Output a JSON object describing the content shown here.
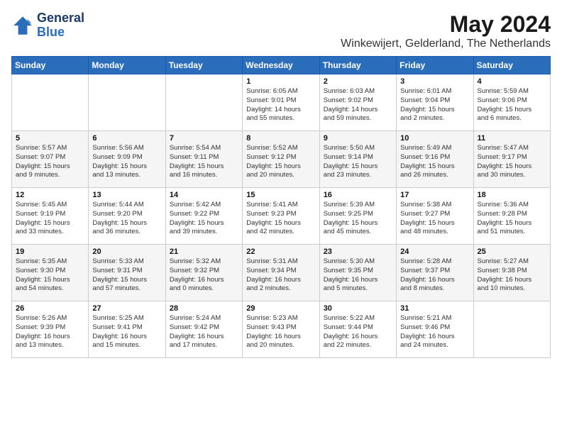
{
  "header": {
    "logo_line1": "General",
    "logo_line2": "Blue",
    "month": "May 2024",
    "location": "Winkewijert, Gelderland, The Netherlands"
  },
  "weekdays": [
    "Sunday",
    "Monday",
    "Tuesday",
    "Wednesday",
    "Thursday",
    "Friday",
    "Saturday"
  ],
  "weeks": [
    [
      {
        "day": "",
        "info": ""
      },
      {
        "day": "",
        "info": ""
      },
      {
        "day": "",
        "info": ""
      },
      {
        "day": "1",
        "info": "Sunrise: 6:05 AM\nSunset: 9:01 PM\nDaylight: 14 hours\nand 55 minutes."
      },
      {
        "day": "2",
        "info": "Sunrise: 6:03 AM\nSunset: 9:02 PM\nDaylight: 14 hours\nand 59 minutes."
      },
      {
        "day": "3",
        "info": "Sunrise: 6:01 AM\nSunset: 9:04 PM\nDaylight: 15 hours\nand 2 minutes."
      },
      {
        "day": "4",
        "info": "Sunrise: 5:59 AM\nSunset: 9:06 PM\nDaylight: 15 hours\nand 6 minutes."
      }
    ],
    [
      {
        "day": "5",
        "info": "Sunrise: 5:57 AM\nSunset: 9:07 PM\nDaylight: 15 hours\nand 9 minutes."
      },
      {
        "day": "6",
        "info": "Sunrise: 5:56 AM\nSunset: 9:09 PM\nDaylight: 15 hours\nand 13 minutes."
      },
      {
        "day": "7",
        "info": "Sunrise: 5:54 AM\nSunset: 9:11 PM\nDaylight: 15 hours\nand 16 minutes."
      },
      {
        "day": "8",
        "info": "Sunrise: 5:52 AM\nSunset: 9:12 PM\nDaylight: 15 hours\nand 20 minutes."
      },
      {
        "day": "9",
        "info": "Sunrise: 5:50 AM\nSunset: 9:14 PM\nDaylight: 15 hours\nand 23 minutes."
      },
      {
        "day": "10",
        "info": "Sunrise: 5:49 AM\nSunset: 9:16 PM\nDaylight: 15 hours\nand 26 minutes."
      },
      {
        "day": "11",
        "info": "Sunrise: 5:47 AM\nSunset: 9:17 PM\nDaylight: 15 hours\nand 30 minutes."
      }
    ],
    [
      {
        "day": "12",
        "info": "Sunrise: 5:45 AM\nSunset: 9:19 PM\nDaylight: 15 hours\nand 33 minutes."
      },
      {
        "day": "13",
        "info": "Sunrise: 5:44 AM\nSunset: 9:20 PM\nDaylight: 15 hours\nand 36 minutes."
      },
      {
        "day": "14",
        "info": "Sunrise: 5:42 AM\nSunset: 9:22 PM\nDaylight: 15 hours\nand 39 minutes."
      },
      {
        "day": "15",
        "info": "Sunrise: 5:41 AM\nSunset: 9:23 PM\nDaylight: 15 hours\nand 42 minutes."
      },
      {
        "day": "16",
        "info": "Sunrise: 5:39 AM\nSunset: 9:25 PM\nDaylight: 15 hours\nand 45 minutes."
      },
      {
        "day": "17",
        "info": "Sunrise: 5:38 AM\nSunset: 9:27 PM\nDaylight: 15 hours\nand 48 minutes."
      },
      {
        "day": "18",
        "info": "Sunrise: 5:36 AM\nSunset: 9:28 PM\nDaylight: 15 hours\nand 51 minutes."
      }
    ],
    [
      {
        "day": "19",
        "info": "Sunrise: 5:35 AM\nSunset: 9:30 PM\nDaylight: 15 hours\nand 54 minutes."
      },
      {
        "day": "20",
        "info": "Sunrise: 5:33 AM\nSunset: 9:31 PM\nDaylight: 15 hours\nand 57 minutes."
      },
      {
        "day": "21",
        "info": "Sunrise: 5:32 AM\nSunset: 9:32 PM\nDaylight: 16 hours\nand 0 minutes."
      },
      {
        "day": "22",
        "info": "Sunrise: 5:31 AM\nSunset: 9:34 PM\nDaylight: 16 hours\nand 2 minutes."
      },
      {
        "day": "23",
        "info": "Sunrise: 5:30 AM\nSunset: 9:35 PM\nDaylight: 16 hours\nand 5 minutes."
      },
      {
        "day": "24",
        "info": "Sunrise: 5:28 AM\nSunset: 9:37 PM\nDaylight: 16 hours\nand 8 minutes."
      },
      {
        "day": "25",
        "info": "Sunrise: 5:27 AM\nSunset: 9:38 PM\nDaylight: 16 hours\nand 10 minutes."
      }
    ],
    [
      {
        "day": "26",
        "info": "Sunrise: 5:26 AM\nSunset: 9:39 PM\nDaylight: 16 hours\nand 13 minutes."
      },
      {
        "day": "27",
        "info": "Sunrise: 5:25 AM\nSunset: 9:41 PM\nDaylight: 16 hours\nand 15 minutes."
      },
      {
        "day": "28",
        "info": "Sunrise: 5:24 AM\nSunset: 9:42 PM\nDaylight: 16 hours\nand 17 minutes."
      },
      {
        "day": "29",
        "info": "Sunrise: 5:23 AM\nSunset: 9:43 PM\nDaylight: 16 hours\nand 20 minutes."
      },
      {
        "day": "30",
        "info": "Sunrise: 5:22 AM\nSunset: 9:44 PM\nDaylight: 16 hours\nand 22 minutes."
      },
      {
        "day": "31",
        "info": "Sunrise: 5:21 AM\nSunset: 9:46 PM\nDaylight: 16 hours\nand 24 minutes."
      },
      {
        "day": "",
        "info": ""
      }
    ]
  ]
}
